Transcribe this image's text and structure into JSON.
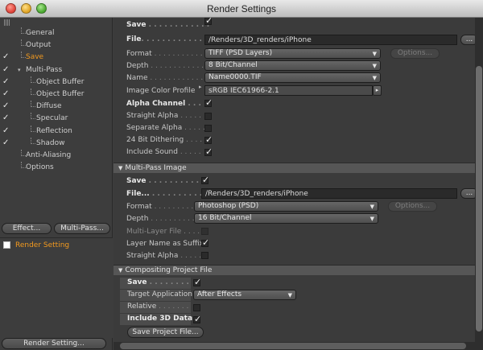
{
  "window": {
    "title": "Render Settings"
  },
  "sidebar": {
    "items": [
      {
        "label": "General",
        "checked": false,
        "indent": 0
      },
      {
        "label": "Output",
        "checked": false,
        "indent": 0
      },
      {
        "label": "Save",
        "checked": true,
        "indent": 0,
        "selected": true
      },
      {
        "label": "Multi-Pass",
        "checked": true,
        "indent": 0,
        "expand": true
      },
      {
        "label": "Object Buffer",
        "checked": true,
        "indent": 1
      },
      {
        "label": "Object Buffer",
        "checked": true,
        "indent": 1
      },
      {
        "label": "Diffuse",
        "checked": true,
        "indent": 1
      },
      {
        "label": "Specular",
        "checked": true,
        "indent": 1
      },
      {
        "label": "Reflection",
        "checked": true,
        "indent": 1
      },
      {
        "label": "Shadow",
        "checked": true,
        "indent": 1
      },
      {
        "label": "Anti-Aliasing",
        "checked": false,
        "indent": 0
      },
      {
        "label": "Options",
        "checked": false,
        "indent": 0
      }
    ],
    "effect_button": "Effect...",
    "multipass_button": "Multi-Pass...",
    "render_setting_item": "Render Setting",
    "render_setting_button": "Render Setting..."
  },
  "save": {
    "top_partial_label": "Save",
    "file_label": "File",
    "file_value": "/Renders/3D_renders/iPhone",
    "format_label": "Format",
    "format_value": "TIFF (PSD Layers)",
    "options_button": "Options...",
    "depth_label": "Depth",
    "depth_value": "8 Bit/Channel",
    "name_label": "Name",
    "name_value": "Name0000.TIF",
    "profile_label": "Image Color Profile",
    "profile_value": "sRGB IEC61966-2.1",
    "alpha_label": "Alpha Channel",
    "alpha_checked": true,
    "straight_label": "Straight Alpha",
    "straight_checked": false,
    "separate_label": "Separate Alpha",
    "separate_checked": false,
    "dither_label": "24 Bit Dithering",
    "dither_checked": true,
    "sound_label": "Include Sound",
    "sound_checked": true
  },
  "multipass": {
    "header": "Multi-Pass Image",
    "save_label": "Save",
    "save_checked": true,
    "file_label": "File...",
    "file_value": "/Renders/3D_renders/iPhone",
    "format_label": "Format",
    "format_value": "Photoshop (PSD)",
    "options_button": "Options...",
    "depth_label": "Depth",
    "depth_value": "16 Bit/Channel",
    "multilayer_label": "Multi-Layer File",
    "layername_label": "Layer Name as Suffix",
    "layername_checked": true,
    "straight_label": "Straight Alpha",
    "straight_checked": false
  },
  "compositing": {
    "header": "Compositing Project File",
    "save_label": "Save",
    "save_checked": true,
    "target_label": "Target Application",
    "target_value": "After Effects",
    "relative_label": "Relative",
    "relative_checked": false,
    "include3d_label": "Include 3D Data",
    "include3d_checked": true,
    "saveproject_button": "Save Project File..."
  },
  "dotbutton": "..."
}
